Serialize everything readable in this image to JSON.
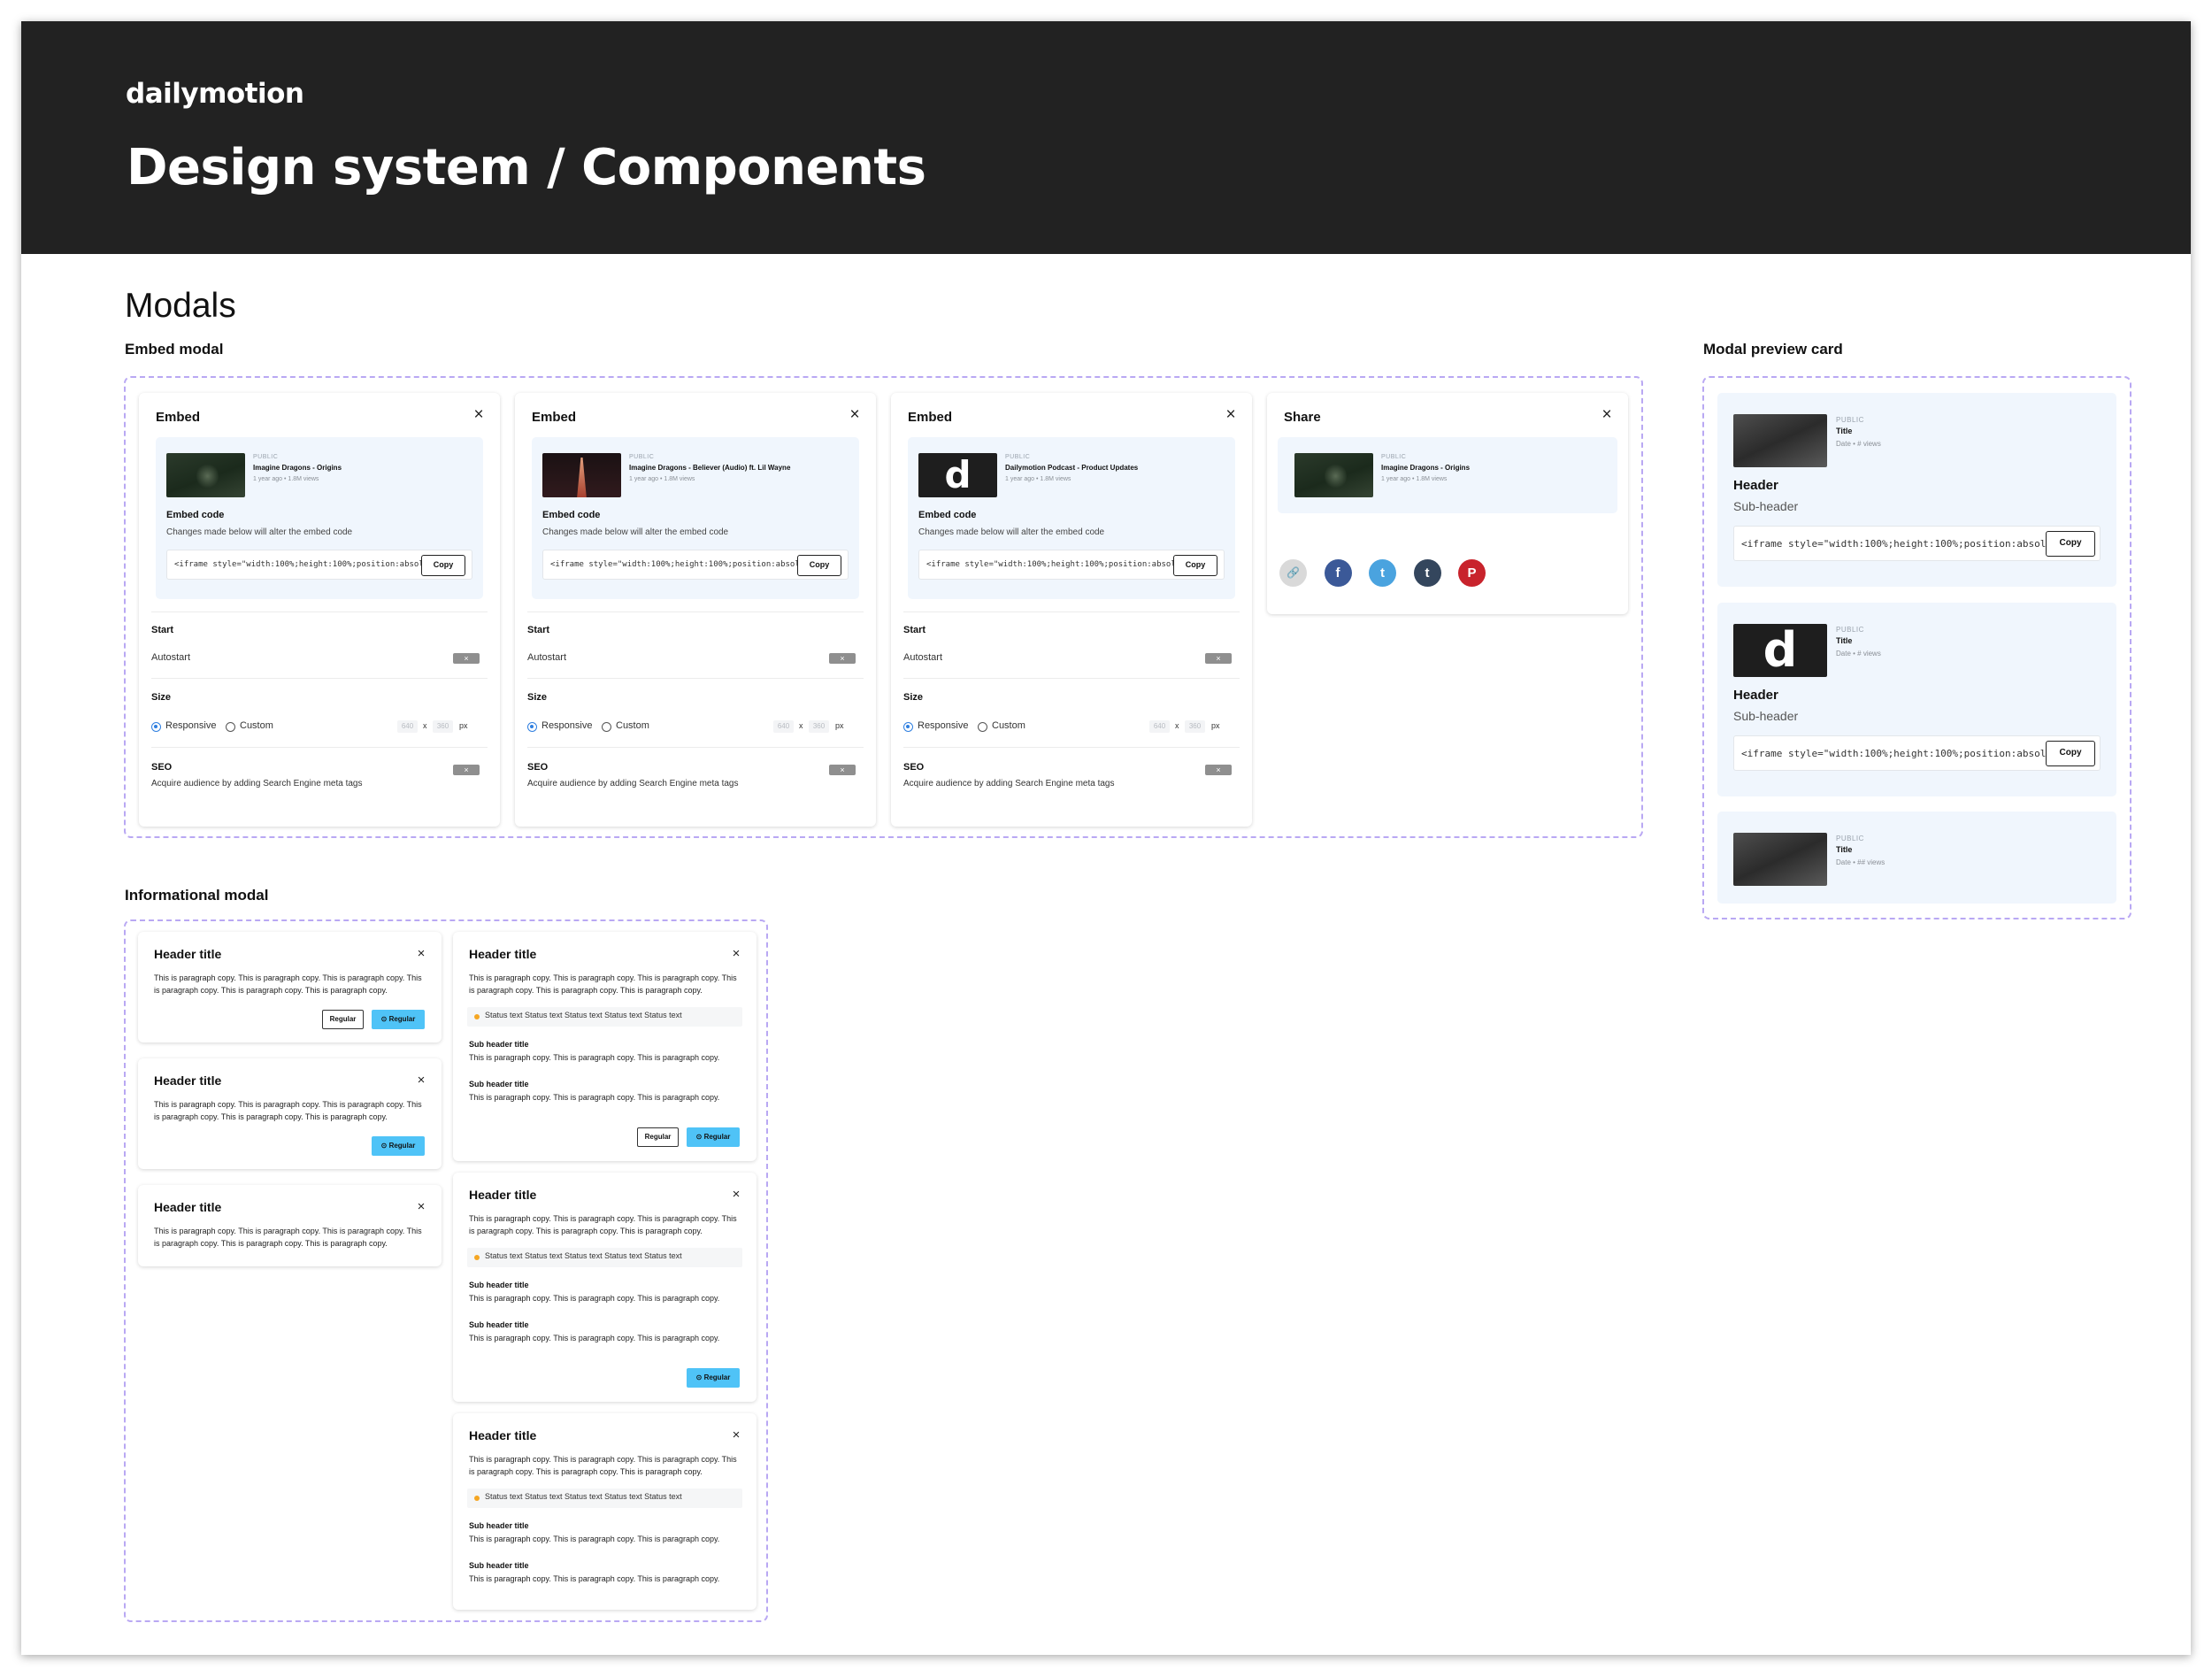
{
  "brand": {
    "logo": "dailymotion",
    "page_title": "Design system / Components"
  },
  "section_title": "Modals",
  "groups": {
    "embed": "Embed modal",
    "info": "Informational modal",
    "preview": "Modal preview card"
  },
  "colors": {
    "hero_bg": "#222222",
    "dash_border": "#b9a8f3",
    "panel_bg": "#f0f6fd",
    "primary_button": "#4fc3f7",
    "status_dot": "#f5a623",
    "radio_selected": "#2f7fe0"
  },
  "embed_modals": [
    {
      "title": "Embed",
      "video_status": "PUBLIC",
      "video_title": "Imagine Dragons - Origins",
      "video_meta": "1 year ago • 1.8M views",
      "thumb": "forest"
    },
    {
      "title": "Embed",
      "video_status": "PUBLIC",
      "video_title": "Imagine Dragons - Believer (Audio) ft. Lil Wayne",
      "video_meta": "1 year ago • 1.8M views",
      "thumb": "red"
    },
    {
      "title": "Embed",
      "video_status": "PUBLIC",
      "video_title": "Dailymotion Podcast - Product Updates",
      "video_meta": "1 year ago • 1.8M views",
      "thumb": "d"
    }
  ],
  "embed_common": {
    "embed_code_label": "Embed code",
    "embed_code_desc": "Changes made below will alter the embed code",
    "code": "<iframe style=\"width:100%;height:100%;position:absolute",
    "copy": "Copy",
    "start_label": "Start",
    "autostart": "Autostart",
    "size_label": "Size",
    "responsive": "Responsive",
    "custom": "Custom",
    "width": "640",
    "by": "x",
    "height": "360",
    "unit": "px",
    "seo_label": "SEO",
    "seo_desc": "Acquire audience by adding Search Engine meta tags",
    "toggle_symbol": "×",
    "close_symbol": "×"
  },
  "share_modal": {
    "title": "Share",
    "video_status": "PUBLIC",
    "video_title": "Imagine Dragons - Origins",
    "video_meta": "1 year ago • 1.8M views",
    "icons": [
      {
        "name": "link-icon",
        "glyph": "🔗",
        "color": "#d9d9d9"
      },
      {
        "name": "facebook-icon",
        "glyph": "f",
        "color": "#3b5998"
      },
      {
        "name": "twitter-icon",
        "glyph": "t",
        "color": "#4aa3df"
      },
      {
        "name": "tumblr-icon",
        "glyph": "t",
        "color": "#34465d"
      },
      {
        "name": "pinterest-icon",
        "glyph": "P",
        "color": "#c8232c"
      }
    ]
  },
  "info_common": {
    "header_title": "Header title",
    "paragraph": "This is paragraph copy. This is paragraph copy. This is paragraph copy. This is paragraph copy. This is paragraph copy. This is paragraph copy.",
    "regular": "Regular",
    "regular_primary": "⊙ Regular",
    "status_text": "Status text Status text Status text Status text Status text",
    "sub_header": "Sub header title",
    "sub_paragraph": "This is paragraph copy. This is paragraph copy. This is paragraph copy."
  },
  "preview_cards": [
    {
      "status": "PUBLIC",
      "title": "Title",
      "meta": "Date • # views",
      "header": "Header",
      "sub_header": "Sub-header",
      "thumb": "gray"
    },
    {
      "status": "PUBLIC",
      "title": "Title",
      "meta": "Date • # views",
      "header": "Header",
      "sub_header": "Sub-header",
      "thumb": "d"
    },
    {
      "status": "PUBLIC",
      "title": "Title",
      "meta": "Date • ## views",
      "thumb": "gray"
    }
  ]
}
